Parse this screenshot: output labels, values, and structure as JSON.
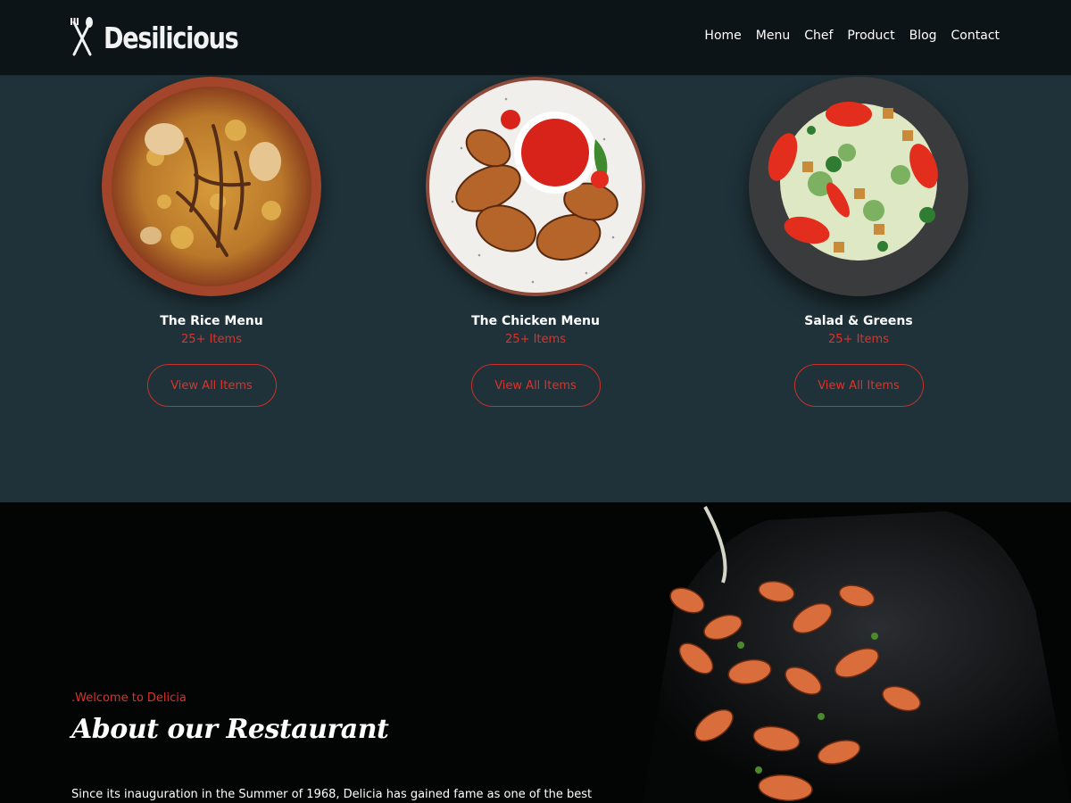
{
  "brand": {
    "name": "Desilicious"
  },
  "nav": {
    "items": [
      "Home",
      "Menu",
      "Chef",
      "Product",
      "Blog",
      "Contact"
    ]
  },
  "menu_categories": [
    {
      "title": "The Rice Menu",
      "count": "25+ Items",
      "button": "View All Items"
    },
    {
      "title": "The Chicken Menu",
      "count": "25+ Items",
      "button": "View All Items"
    },
    {
      "title": "Salad & Greens",
      "count": "25+ Items",
      "button": "View All Items"
    }
  ],
  "about": {
    "kicker": ".Welcome to Delicia",
    "title": "About our Restaurant",
    "text": "Since its inauguration in the Summer of 1968, Delicia has gained fame as one of the best"
  },
  "colors": {
    "accent": "#d9342b",
    "header_bg": "#0d1417",
    "menu_bg": "#1f3239",
    "about_bg": "#030404"
  }
}
